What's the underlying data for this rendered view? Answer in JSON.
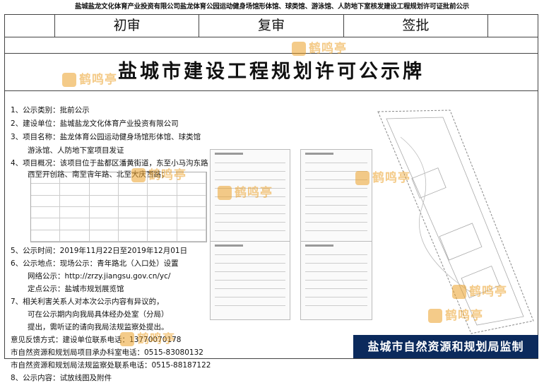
{
  "header": {
    "caption": "盐城盐龙文化体育产业投资有限公司盐龙体育公园运动健身场馆形体馆、球类馆、游泳馆、人防地下室核发建设工程规划许可证批前公示"
  },
  "approval_row": {
    "first_review": "初审",
    "second_review": "复审",
    "sign_off": "签批"
  },
  "board": {
    "title": "盐城市建设工程规划许可公示牌"
  },
  "info": {
    "l1": "1、公示类别：批前公示",
    "l2": "2、建设单位：盐城盐龙文化体育产业投资有限公司",
    "l3": "3、项目名称：盐龙体育公园运动健身场馆形体馆、球类馆",
    "l3b": "游泳馆、人防地下室项目发证",
    "l4": "4、项目概况：该项目位于盐都区潘黄街道，东至小马沟东路",
    "l4b": "西至开创路、南至青年路、北至大庆西路；",
    "l5": "5、公示时间：2019年11月22日至2019年12月01日",
    "l6": "6、公示地点：现场公示：青年路北（入口处）设置",
    "l6b": "网络公示：http://zrzy.jiangsu.gov.cn/yc/",
    "l6c": "定点公示：盐城市规划展览馆",
    "l7": "7、相关利害关系人对本次公示内容有异议的，",
    "l7b": "可在公示期内向我局具体经办处室（分局）",
    "l7c": "提出，需听证的请向我局法规监察处提出。",
    "l7d": "意见反馈方式：建设单位联系电话：13770070178",
    "l7e": "市自然资源和规划局项目承办科室电话：0515-83080132",
    "l7f": "市自然资源和规划局法规监察处联系电话：0515-88187122",
    "l8": "8、公示内容：试放线图及附件"
  },
  "footer": {
    "banner": "盐城市自然资源和规划局监制"
  },
  "watermark": {
    "text": "鹤鸣亭"
  }
}
